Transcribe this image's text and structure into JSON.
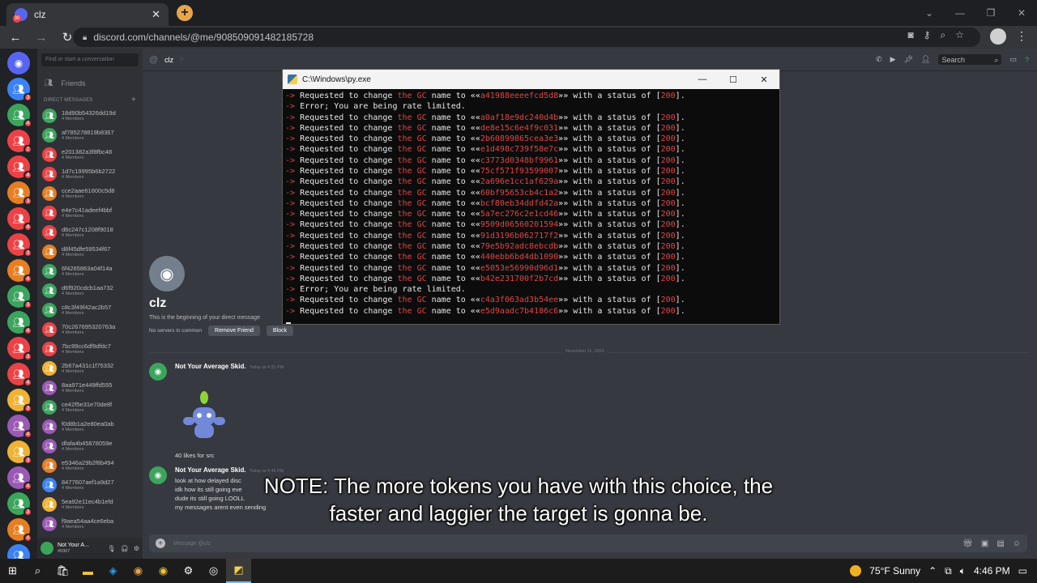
{
  "browser": {
    "tab_title": "clz",
    "tab_badge": "30",
    "url": "discord.com/channels/@me/908509091482185728"
  },
  "dm_sidebar": {
    "search_placeholder": "Find or start a conversation",
    "friends_label": "Friends",
    "direct_messages_header": "DIRECT MESSAGES",
    "items": [
      {
        "name": "18d90b54326dd19d",
        "sub": "4 Members",
        "color": "#3ba55c"
      },
      {
        "name": "af785278819b8367",
        "sub": "4 Members",
        "color": "#3ba55c"
      },
      {
        "name": "e201382a3f8fbc48",
        "sub": "4 Members",
        "color": "#ed4245"
      },
      {
        "name": "1d7c19995b6b2722",
        "sub": "4 Members",
        "color": "#ed4245"
      },
      {
        "name": "cce2aae61600c5d8",
        "sub": "4 Members",
        "color": "#e67e22"
      },
      {
        "name": "e4e7c41adeef4bbf",
        "sub": "4 Members",
        "color": "#ed4245"
      },
      {
        "name": "d6c247c1208f9018",
        "sub": "4 Members",
        "color": "#ed4245"
      },
      {
        "name": "d8f45dfe59534f67",
        "sub": "4 Members",
        "color": "#e67e22"
      },
      {
        "name": "6f4265863a04f14a",
        "sub": "4 Members",
        "color": "#3ba55c"
      },
      {
        "name": "d6f920cdcb1aa732",
        "sub": "4 Members",
        "color": "#3ba55c"
      },
      {
        "name": "c8c3f49f42ac2b57",
        "sub": "4 Members",
        "color": "#3ba55c"
      },
      {
        "name": "70c267695320763a",
        "sub": "4 Members",
        "color": "#ed4245"
      },
      {
        "name": "7bc99cc6df9dfdc7",
        "sub": "4 Members",
        "color": "#ed4245"
      },
      {
        "name": "2b67a431c1f75332",
        "sub": "4 Members",
        "color": "#f0b232"
      },
      {
        "name": "8aa971e449ffd555",
        "sub": "4 Members",
        "color": "#9b59b6"
      },
      {
        "name": "ce42f5e31e70de8f",
        "sub": "4 Members",
        "color": "#3ba55c"
      },
      {
        "name": "f0d8b1a2e80ea0ab",
        "sub": "4 Members",
        "color": "#9b59b6"
      },
      {
        "name": "dfafa4b45878059e",
        "sub": "4 Members",
        "color": "#9b59b6"
      },
      {
        "name": "e5346a29b2f8b494",
        "sub": "4 Members",
        "color": "#e67e22"
      },
      {
        "name": "8477607aef1a9d27",
        "sub": "4 Members",
        "color": "#3b82f6"
      },
      {
        "name": "5ea92e11ec4b1efd",
        "sub": "4 Members",
        "color": "#f0b232"
      },
      {
        "name": "f9aea54aa4ce6eba",
        "sub": "4 Members",
        "color": "#9b59b6"
      }
    ],
    "user": {
      "name": "Not Your A...",
      "tag": "#0307"
    }
  },
  "guilds": [
    {
      "color": "#5865f2",
      "badge": ""
    },
    {
      "color": "#3b82f6",
      "badge": "3"
    },
    {
      "color": "#3ba55c",
      "badge": "4"
    },
    {
      "color": "#ed4245",
      "badge": "2"
    },
    {
      "color": "#ed4245",
      "badge": "4"
    },
    {
      "color": "#e67e22",
      "badge": "3"
    },
    {
      "color": "#ed4245",
      "badge": "4"
    },
    {
      "color": "#ed4245",
      "badge": "3"
    },
    {
      "color": "#e67e22",
      "badge": "4"
    },
    {
      "color": "#3ba55c",
      "badge": "3"
    },
    {
      "color": "#3ba55c",
      "badge": "4"
    },
    {
      "color": "#ed4245",
      "badge": "3"
    },
    {
      "color": "#ed4245",
      "badge": "4"
    },
    {
      "color": "#f0b232",
      "badge": "3"
    },
    {
      "color": "#9b59b6",
      "badge": "4"
    },
    {
      "color": "#f0b232",
      "badge": "3"
    },
    {
      "color": "#9b59b6",
      "badge": "4"
    },
    {
      "color": "#3ba55c",
      "badge": "3"
    },
    {
      "color": "#e67e22",
      "badge": "4"
    },
    {
      "color": "#3b82f6",
      "badge": "3"
    },
    {
      "color": "#9b59b6",
      "badge": "4"
    }
  ],
  "chat": {
    "channel_name": "clz",
    "search_placeholder": "Search",
    "welcome_name": "clz",
    "welcome_text": "This is the beginning of your direct message",
    "no_servers": "No servers in common",
    "remove_friend": "Remove Friend",
    "block": "Block",
    "date_divider": "November 11, 2021",
    "messages": [
      {
        "author": "Not Your Average Skid.",
        "time": "Today at 4:31 PM",
        "lines": [
          "40 likes for src"
        ]
      },
      {
        "author": "Not Your Average Skid.",
        "time": "Today at 4:46 PM",
        "lines": [
          "look at how delayed disc",
          "idk how its still going eve",
          "dude its still going LOOLL",
          "my messages arent even sending"
        ]
      }
    ],
    "composer_placeholder": "Message @clz"
  },
  "console": {
    "title": "C:\\Windows\\py.exe",
    "lines": [
      {
        "type": "ok",
        "hash": "a41988eeeefcd5d8"
      },
      {
        "type": "err",
        "text": "Error; You are being rate limited."
      },
      {
        "type": "ok",
        "hash": "a0af18e9dc240d4b"
      },
      {
        "type": "ok",
        "hash": "de8e15c6e4f9c031"
      },
      {
        "type": "ok",
        "hash": "2b60899865cea3e3"
      },
      {
        "type": "ok",
        "hash": "e1d498c739f58e7c"
      },
      {
        "type": "ok",
        "hash": "c3773d0348bf9961"
      },
      {
        "type": "ok",
        "hash": "75cf571f93599007"
      },
      {
        "type": "ok",
        "hash": "2a696e1cc1af629a"
      },
      {
        "type": "ok",
        "hash": "60bf95653cb4c1a2"
      },
      {
        "type": "ok",
        "hash": "bcf80eb34ddfd42a"
      },
      {
        "type": "ok",
        "hash": "5a7ec276c2e1cd46"
      },
      {
        "type": "ok",
        "hash": "9509d06560201594"
      },
      {
        "type": "ok",
        "hash": "91d3196b062717f2"
      },
      {
        "type": "ok",
        "hash": "79e5b92adc8ebcdb"
      },
      {
        "type": "ok",
        "hash": "440ebb6bd4db1090"
      },
      {
        "type": "ok",
        "hash": "e5053e56990d96d1"
      },
      {
        "type": "ok",
        "hash": "b42e231700f2b7cd"
      },
      {
        "type": "err",
        "text": "Error; You are being rate limited."
      },
      {
        "type": "ok",
        "hash": "c4a3f063ad3b54ee"
      },
      {
        "type": "ok",
        "hash": "e5d9aadc7b4186c6"
      }
    ],
    "ok_prefix": "Requested to change ",
    "ok_hi": "the GC",
    "ok_mid": " name to ««",
    "ok_after": "»» with a status of [",
    "ok_code": "200",
    "ok_end": "]."
  },
  "subtitle": {
    "line1": "NOTE: The more tokens you have with this choice, the",
    "line2": "faster and laggier the target is gonna be."
  },
  "taskbar": {
    "weather": "75°F  Sunny",
    "time": "4:46 PM"
  }
}
